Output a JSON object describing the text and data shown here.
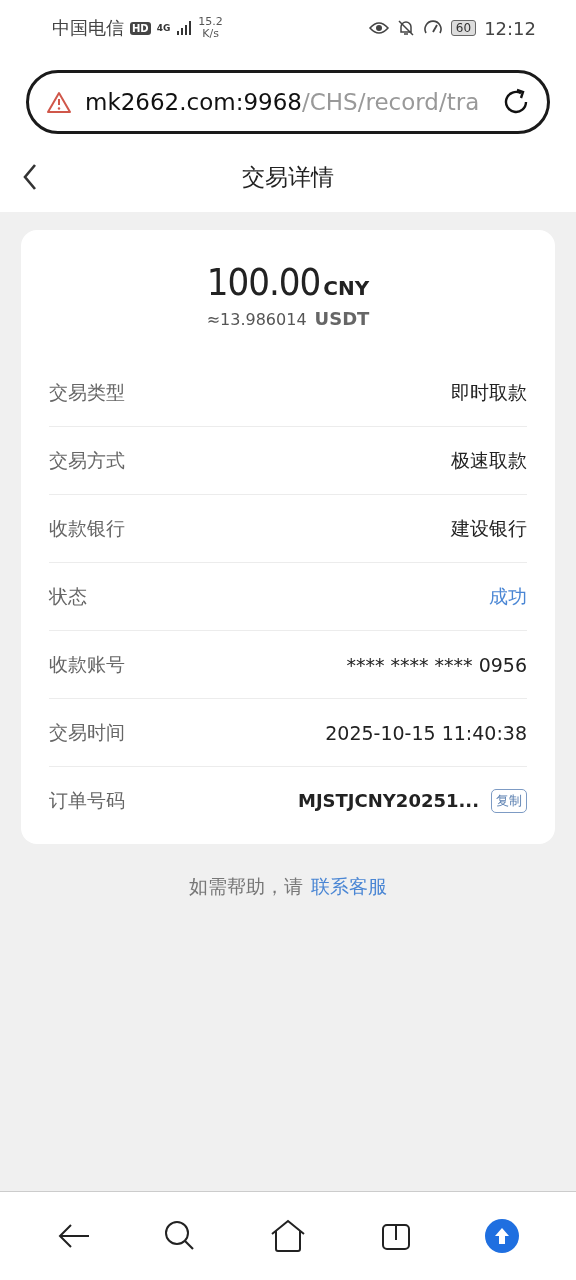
{
  "status_bar": {
    "carrier": "中国电信",
    "hd": "HD",
    "network": "4G",
    "speed": "15.2",
    "speed_unit": "K/s",
    "battery": "60",
    "time": "12:12"
  },
  "address_bar": {
    "host": "mk2662.com:9968",
    "path": "/CHS/record/tra"
  },
  "header": {
    "title": "交易详情"
  },
  "amount": {
    "value": "100.00",
    "currency": "CNY",
    "approx": "≈13.986014",
    "approx_currency": "USDT"
  },
  "details": [
    {
      "label": "交易类型",
      "value": "即时取款",
      "kind": "text"
    },
    {
      "label": "交易方式",
      "value": "极速取款",
      "kind": "text"
    },
    {
      "label": "收款银行",
      "value": "建设银行",
      "kind": "text"
    },
    {
      "label": "状态",
      "value": "成功",
      "kind": "status",
      "color": "#4a86d4"
    },
    {
      "label": "收款账号",
      "value": "**** **** **** 0956",
      "kind": "text"
    },
    {
      "label": "交易时间",
      "value": "2025-10-15 11:40:38",
      "kind": "text"
    },
    {
      "label": "订单号码",
      "value": "MJSTJCNY20251...",
      "kind": "order",
      "action": "复制"
    }
  ],
  "help": {
    "text": "如需帮助，请",
    "link": "联系客服"
  }
}
